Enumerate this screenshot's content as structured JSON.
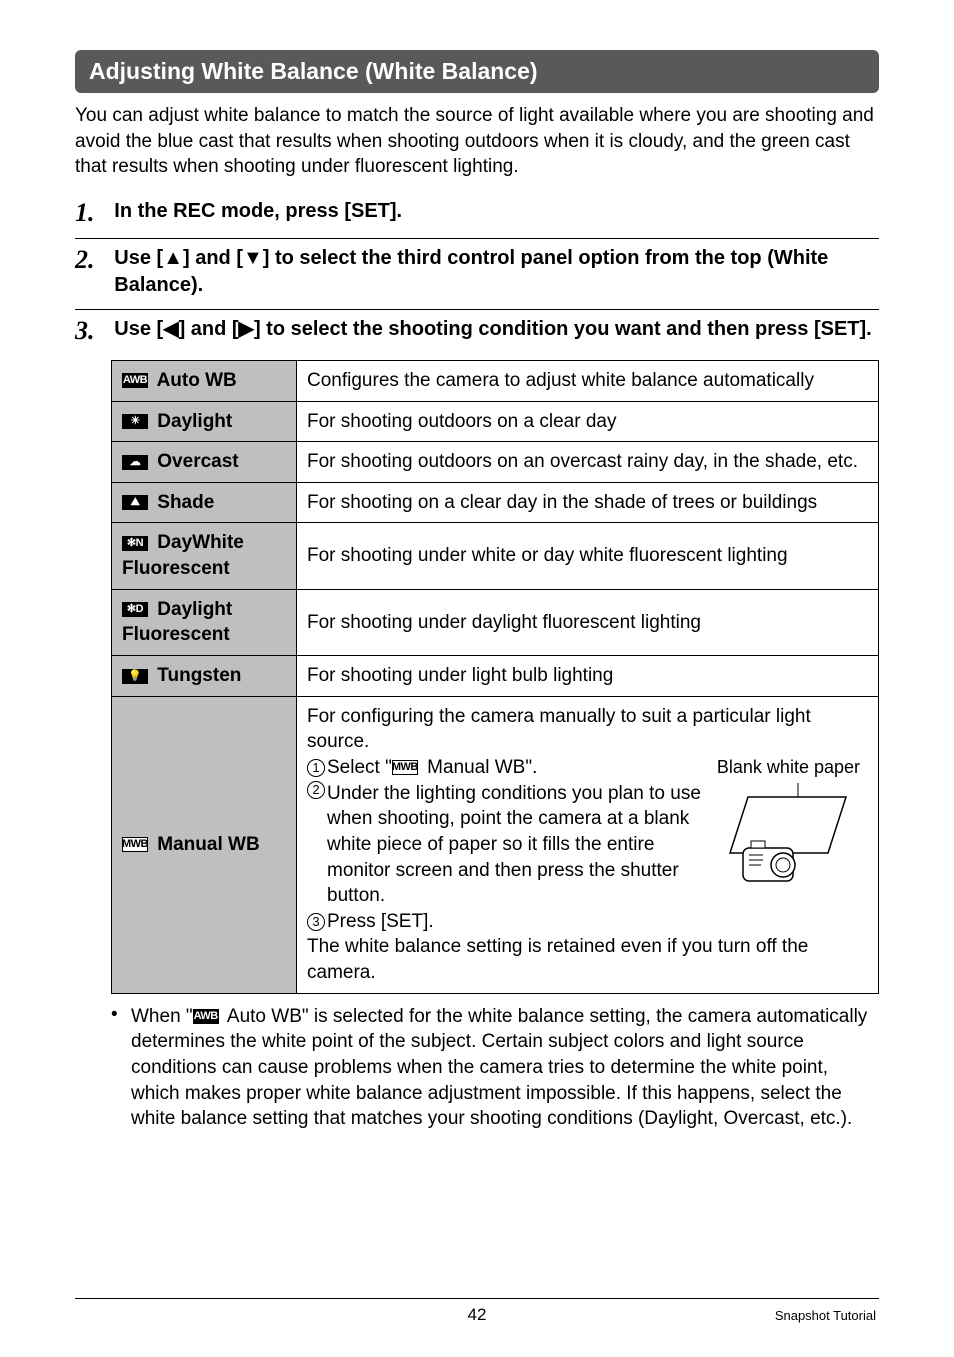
{
  "title": "Adjusting White Balance (White Balance)",
  "intro": "You can adjust white balance to match the source of light available where you are shooting and avoid the blue cast that results when shooting outdoors when it is cloudy, and the green cast that results when shooting under fluorescent lighting.",
  "steps": [
    {
      "num": "1.",
      "text": "In the REC mode, press [SET]."
    },
    {
      "num": "2.",
      "text": "Use [▲] and [▼] to select the third control panel option from the top (White Balance)."
    },
    {
      "num": "3.",
      "text": "Use [◀] and [▶] to select the shooting condition you want and then press [SET]."
    }
  ],
  "rows": [
    {
      "icon": "AWB",
      "label": "Auto WB",
      "desc": "Configures the camera to adjust white balance automatically"
    },
    {
      "icon": "☀",
      "label": "Daylight",
      "desc": "For shooting outdoors on a clear day"
    },
    {
      "icon": "☁",
      "label": "Overcast",
      "desc": "For shooting outdoors on an overcast rainy day, in the shade, etc."
    },
    {
      "icon": "⛰",
      "label": "Shade",
      "desc": "For shooting on a clear day in the shade of trees or buildings"
    },
    {
      "icon": "N",
      "label": "DayWhite Fluorescent",
      "desc": "For shooting under white or day white fluorescent lighting"
    },
    {
      "icon": "D",
      "label": "Daylight Fluorescent",
      "desc": "For shooting under daylight fluorescent lighting"
    },
    {
      "icon": "💡",
      "label": "Tungsten",
      "desc": "For shooting under light bulb lighting"
    }
  ],
  "manual": {
    "icon": "MWB",
    "label": "Manual WB",
    "line1": "For configuring the camera manually to suit a particular light source.",
    "s1_pre": "Select \"",
    "s1_icon": "MWB",
    "s1_post": " Manual WB\".",
    "s2": "Under the lighting conditions you plan to use when shooting, point the camera at a blank white piece of paper so it fills the entire monitor screen and then press the shutter button.",
    "s3": "Press [SET].",
    "line2": "The white balance setting is retained even if you turn off the camera.",
    "paper_label": "Blank white paper"
  },
  "note_pre": "When \"",
  "note_icon": "AWB",
  "note_post": " Auto WB\" is selected for the white balance setting, the camera automatically determines the white point of the subject. Certain subject colors and light source conditions can cause problems when the camera tries to determine the white point, which makes proper white balance adjustment impossible. If this happens, select the white balance setting that matches your shooting conditions (Daylight, Overcast, etc.).",
  "footer": {
    "page": "42",
    "section": "Snapshot Tutorial"
  }
}
